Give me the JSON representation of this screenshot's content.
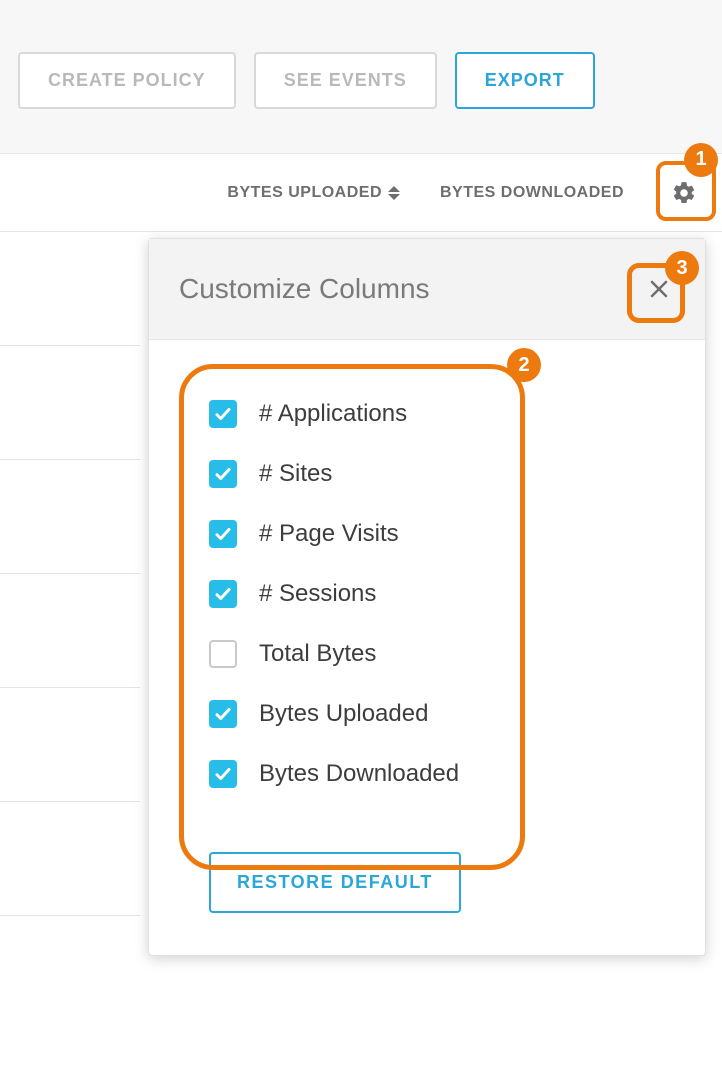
{
  "toolbar": {
    "create_policy": "CREATE POLICY",
    "see_events": "SEE EVENTS",
    "export": "EXPORT"
  },
  "columns": {
    "bytes_uploaded": "BYTES UPLOADED",
    "bytes_downloaded": "BYTES DOWNLOADED"
  },
  "popover": {
    "title": "Customize Columns",
    "restore": "RESTORE DEFAULT",
    "options": [
      {
        "label": "# Applications",
        "checked": true
      },
      {
        "label": "# Sites",
        "checked": true
      },
      {
        "label": "# Page Visits",
        "checked": true
      },
      {
        "label": "# Sessions",
        "checked": true
      },
      {
        "label": "Total Bytes",
        "checked": false
      },
      {
        "label": "Bytes Uploaded",
        "checked": true
      },
      {
        "label": "Bytes Downloaded",
        "checked": true
      }
    ]
  },
  "callouts": {
    "c1": "1",
    "c2": "2",
    "c3": "3"
  }
}
